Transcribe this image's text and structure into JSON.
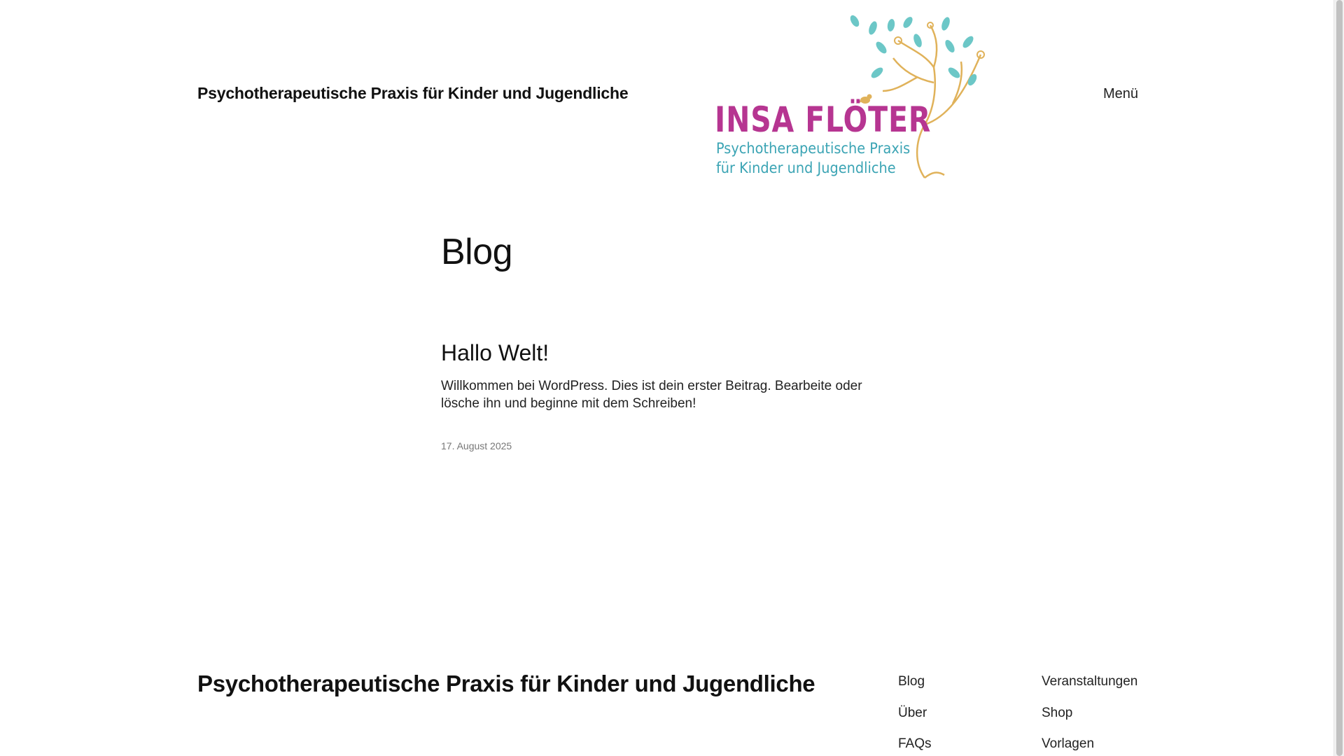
{
  "header": {
    "site_title": "Psychotherapeutische Praxis für Kinder und Jugendliche",
    "menu_label": "Menü"
  },
  "logo": {
    "name": "INSA FLÖTER",
    "line1": "Psychotherapeutische Praxis",
    "line2": "für Kinder und Jugendliche",
    "colors": {
      "name": "#b63591",
      "subtitle": "#3ba4b4",
      "tree": "#e0b25a",
      "leaves": "#6cc7c7"
    }
  },
  "main": {
    "page_title": "Blog",
    "posts": [
      {
        "title": "Hallo Welt!",
        "excerpt": "Willkommen bei WordPress. Dies ist dein erster Beitrag. Bearbeite oder lösche ihn und beginne mit dem Schreiben!",
        "date": "17. August 2025"
      }
    ]
  },
  "footer": {
    "site_title": "Psychotherapeutische Praxis für Kinder und Jugendliche",
    "nav_col1": [
      "Blog",
      "Über",
      "FAQs"
    ],
    "nav_col2": [
      "Veranstaltungen",
      "Shop",
      "Vorlagen"
    ]
  }
}
